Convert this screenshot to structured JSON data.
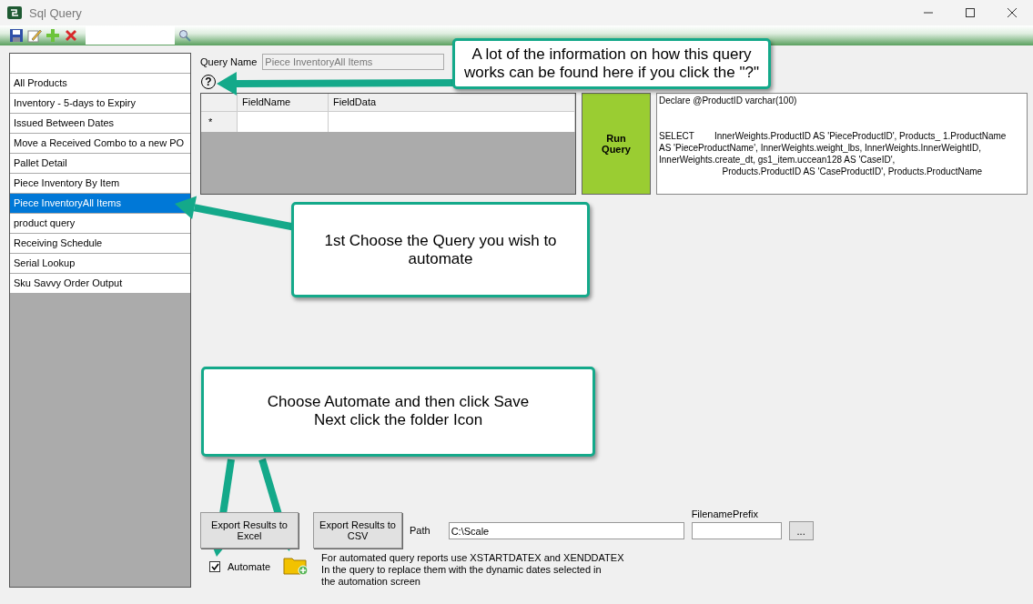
{
  "window": {
    "title": "Sql Query"
  },
  "queries": [
    {
      "label": "All Products",
      "selected": false
    },
    {
      "label": "Inventory - 5-days to Expiry",
      "selected": false
    },
    {
      "label": "Issued Between Dates",
      "selected": false
    },
    {
      "label": "Move a Received Combo to a new PO",
      "selected": false
    },
    {
      "label": "Pallet Detail",
      "selected": false
    },
    {
      "label": "Piece Inventory By Item",
      "selected": false
    },
    {
      "label": "Piece InventoryAll Items",
      "selected": true
    },
    {
      "label": "product query",
      "selected": false
    },
    {
      "label": "Receiving Schedule",
      "selected": false
    },
    {
      "label": "Serial Lookup",
      "selected": false
    },
    {
      "label": "Sku Savvy Order Output",
      "selected": false
    }
  ],
  "query_name": {
    "label": "Query Name",
    "value": "Piece InventoryAll Items"
  },
  "help": {
    "label": "?"
  },
  "grid": {
    "columns": [
      "FieldName",
      "FieldData"
    ],
    "new_row_marker": "*"
  },
  "run_button": {
    "label": "Run\nQuery"
  },
  "sql": [
    "Declare @ProductID varchar(100)",
    "SELECT        InnerWeights.ProductID AS 'PieceProductID', Products_ 1.ProductName AS 'PieceProductName', InnerWeights.weight_lbs, InnerWeights.InnerWeightID, InnerWeights.create_dt, gs1_item.uccean128 AS 'CaseID',",
    "                         Products.ProductID AS 'CaseProductID', Products.ProductName"
  ],
  "export": {
    "excel": "Export Results to Excel",
    "csv": "Export Results to CSV"
  },
  "path": {
    "label": "Path",
    "value": "C:\\Scale"
  },
  "filename_prefix": {
    "label": "FilenamePrefix"
  },
  "browse": {
    "label": "..."
  },
  "automate": {
    "label": "Automate",
    "checked": true
  },
  "note": [
    "For automated query reports use XSTARTDATEX and XENDDATEX",
    "In the query to replace them with the dynamic dates selected in",
    "the automation screen"
  ],
  "callouts": [
    "A lot of the information on how this query works can be found here if you click the \"?\"",
    "1st Choose the Query you wish to automate",
    "Choose Automate and then click Save\nNext click the folder Icon"
  ]
}
